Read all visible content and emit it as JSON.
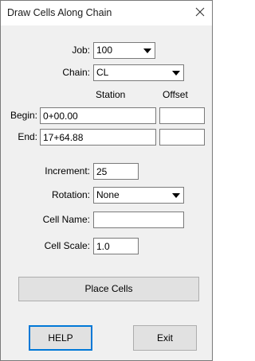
{
  "window": {
    "title": "Draw Cells Along Chain"
  },
  "icons": {
    "close": "close-icon",
    "dropdown": "chevron-down-icon"
  },
  "form": {
    "job_label": "Job:",
    "job_value": "100",
    "chain_label": "Chain:",
    "chain_value": "CL",
    "station_header": "Station",
    "offset_header": "Offset",
    "begin_label": "Begin:",
    "begin_station": "0+00.00",
    "begin_offset": "",
    "end_label": "End:",
    "end_station": "17+64.88",
    "end_offset": "",
    "increment_label": "Increment:",
    "increment_value": "25",
    "rotation_label": "Rotation:",
    "rotation_value": "None",
    "cell_name_label": "Cell Name:",
    "cell_name_value": "",
    "cell_scale_label": "Cell Scale:",
    "cell_scale_value": "1.0"
  },
  "buttons": {
    "place_cells": "Place Cells",
    "help": "HELP",
    "exit": "Exit"
  }
}
